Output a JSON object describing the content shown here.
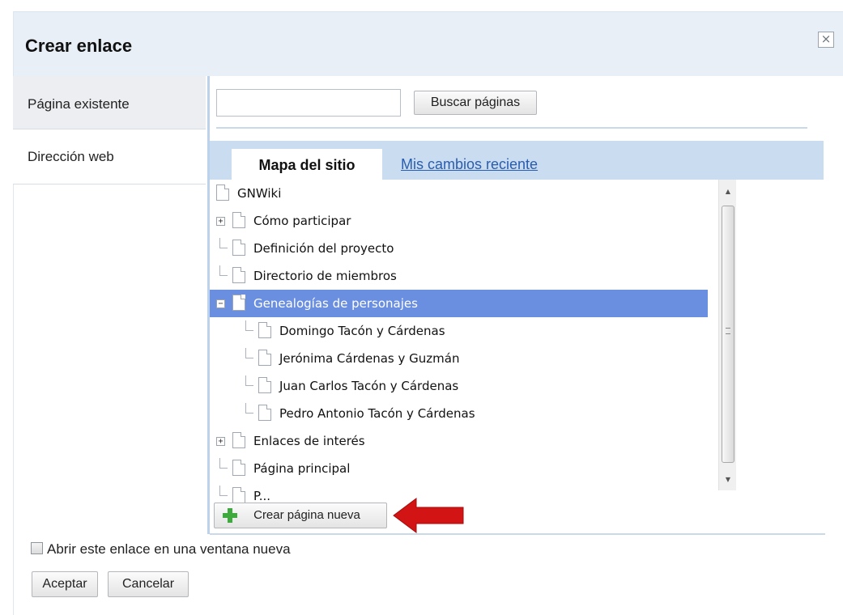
{
  "dialog": {
    "title": "Crear enlace",
    "close_label": "×"
  },
  "sidebar": {
    "items": [
      {
        "label": "Página existente"
      },
      {
        "label": "Dirección web"
      }
    ]
  },
  "search": {
    "value": "",
    "button_label": "Buscar páginas"
  },
  "tabs": [
    {
      "label": "Mapa del sitio",
      "active": true
    },
    {
      "label": "Mis cambios reciente",
      "active": false
    }
  ],
  "tree": [
    {
      "label": "GNWiki",
      "depth": 0,
      "expander": null,
      "connector": false,
      "selected": false
    },
    {
      "label": "Cómo participar",
      "depth": 0,
      "expander": "+",
      "connector": false,
      "selected": false
    },
    {
      "label": "Definición del proyecto",
      "depth": 0,
      "expander": null,
      "connector": true,
      "selected": false
    },
    {
      "label": "Directorio de miembros",
      "depth": 0,
      "expander": null,
      "connector": true,
      "selected": false
    },
    {
      "label": "Genealogías de personajes",
      "depth": 0,
      "expander": "−",
      "connector": false,
      "selected": true
    },
    {
      "label": "Domingo Tacón y Cárdenas",
      "depth": 1,
      "expander": null,
      "connector": true,
      "selected": false
    },
    {
      "label": "Jerónima Cárdenas y Guzmán",
      "depth": 1,
      "expander": null,
      "connector": true,
      "selected": false
    },
    {
      "label": "Juan Carlos Tacón y Cárdenas",
      "depth": 1,
      "expander": null,
      "connector": true,
      "selected": false
    },
    {
      "label": "Pedro Antonio Tacón y Cárdenas",
      "depth": 1,
      "expander": null,
      "connector": true,
      "selected": false
    },
    {
      "label": "Enlaces de interés",
      "depth": 0,
      "expander": "+",
      "connector": false,
      "selected": false
    },
    {
      "label": "Página principal",
      "depth": 0,
      "expander": null,
      "connector": true,
      "selected": false
    },
    {
      "label": "P...",
      "depth": 0,
      "expander": null,
      "connector": true,
      "selected": false
    }
  ],
  "scrollbar": {
    "up_arrow": "▲",
    "down_arrow": "▼"
  },
  "actions": {
    "new_page_label": "Crear página nueva",
    "new_window_label": "Abrir este enlace en una ventana nueva",
    "new_window_checked": false,
    "ok_label": "Aceptar",
    "cancel_label": "Cancelar"
  },
  "colors": {
    "selected_row": "#6b8fe0",
    "tab_bar": "#c9dcf0",
    "link": "#2a5db0",
    "plus_icon": "#3caa3c",
    "annotation_arrow": "#d21414"
  },
  "icons": {
    "page": "page-icon",
    "plus": "plus-icon",
    "close": "close-icon",
    "arrow": "red-arrow-icon"
  }
}
